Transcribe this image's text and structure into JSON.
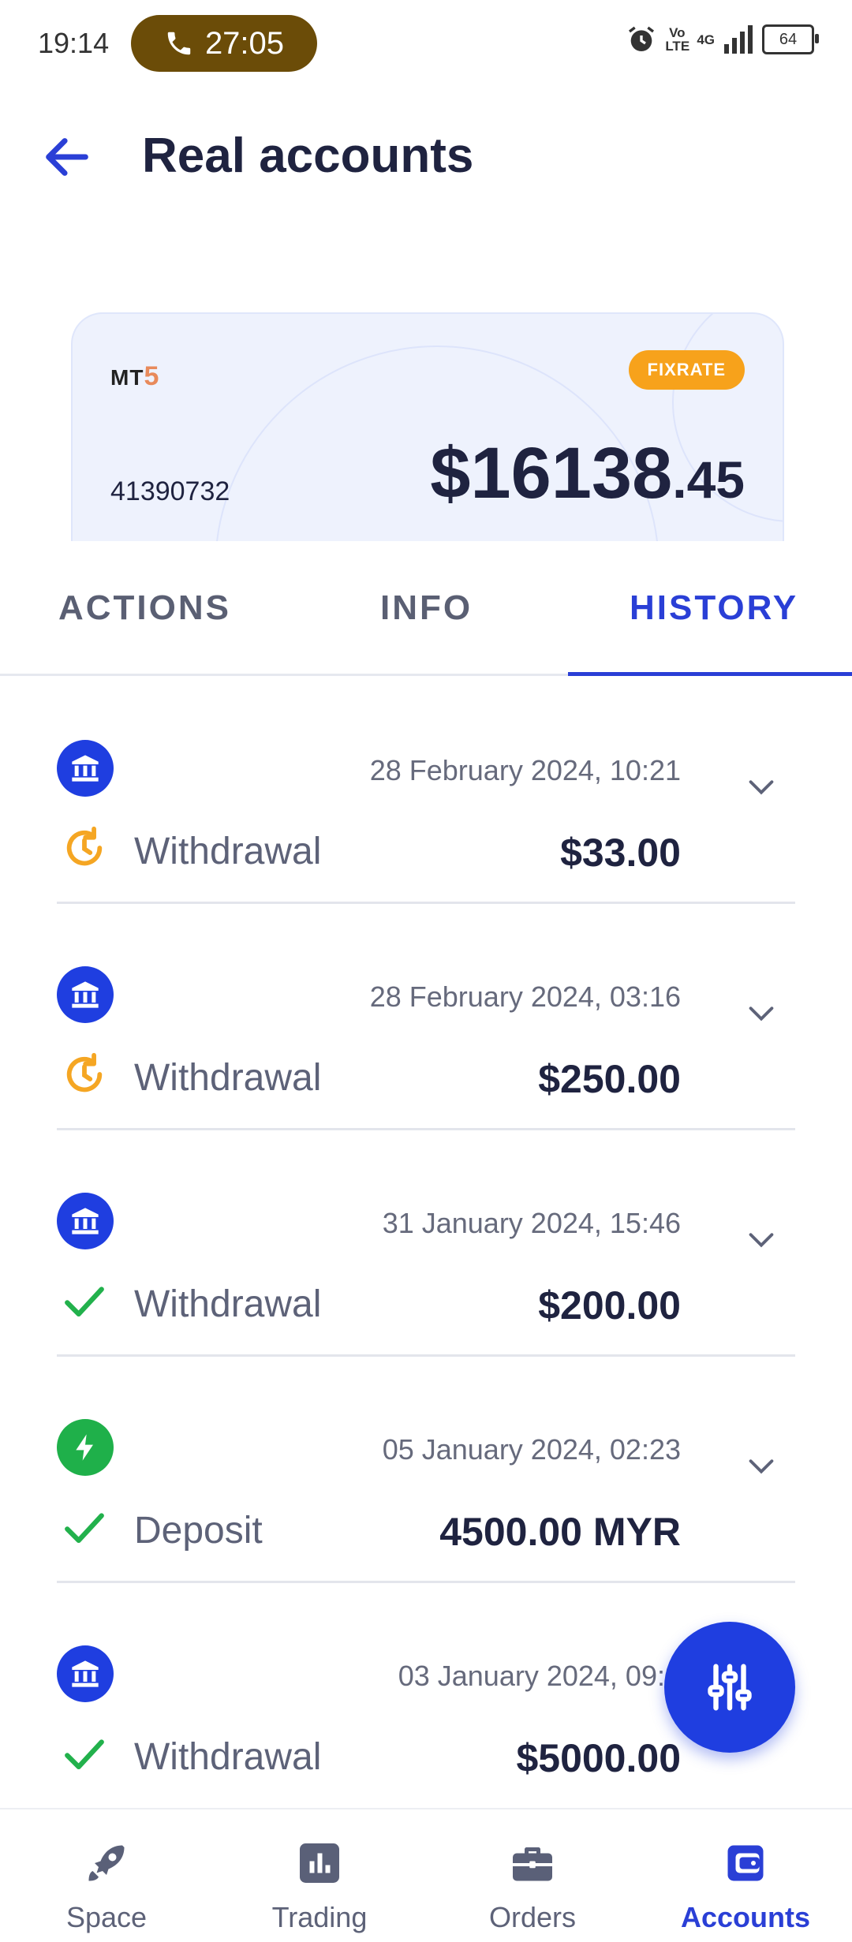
{
  "status_bar": {
    "time": "19:14",
    "call_duration": "27:05",
    "network_lte": "Vo LTE",
    "network_4g": "4G",
    "battery": "64"
  },
  "header": {
    "title": "Real accounts"
  },
  "account_card": {
    "platform_prefix": "MT",
    "platform_version": "5",
    "badge": "FIXRATE",
    "account_number": "41390732",
    "balance_main": "$16138",
    "balance_cents": ".45"
  },
  "tabs": [
    {
      "label": "ACTIONS",
      "active": false
    },
    {
      "label": "INFO",
      "active": false
    },
    {
      "label": "HISTORY",
      "active": true
    }
  ],
  "history": [
    {
      "date": "28 February 2024, 10:21",
      "type": "Withdrawal",
      "amount": "$33.00",
      "method": "bank",
      "status": "pending"
    },
    {
      "date": "28 February 2024, 03:16",
      "type": "Withdrawal",
      "amount": "$250.00",
      "method": "bank",
      "status": "pending"
    },
    {
      "date": "31 January 2024, 15:46",
      "type": "Withdrawal",
      "amount": "$200.00",
      "method": "bank",
      "status": "completed"
    },
    {
      "date": "05 January 2024, 02:23",
      "type": "Deposit",
      "amount": "4500.00 MYR",
      "method": "instant",
      "status": "completed"
    },
    {
      "date": "03 January 2024, 09:3",
      "type": "Withdrawal",
      "amount": "$5000.00",
      "method": "bank",
      "status": "completed"
    }
  ],
  "bottom_nav": [
    {
      "label": "Space",
      "icon": "rocket-icon",
      "active": false
    },
    {
      "label": "Trading",
      "icon": "chart-icon",
      "active": false
    },
    {
      "label": "Orders",
      "icon": "briefcase-icon",
      "active": false
    },
    {
      "label": "Accounts",
      "icon": "wallet-icon",
      "active": true
    }
  ],
  "colors": {
    "accent": "#2a3fd6",
    "bank_icon_bg": "#1f3ee0",
    "instant_icon_bg": "#1fb04a",
    "pending": "#f5a623",
    "completed": "#22b14c",
    "badge": "#f7a21b"
  }
}
